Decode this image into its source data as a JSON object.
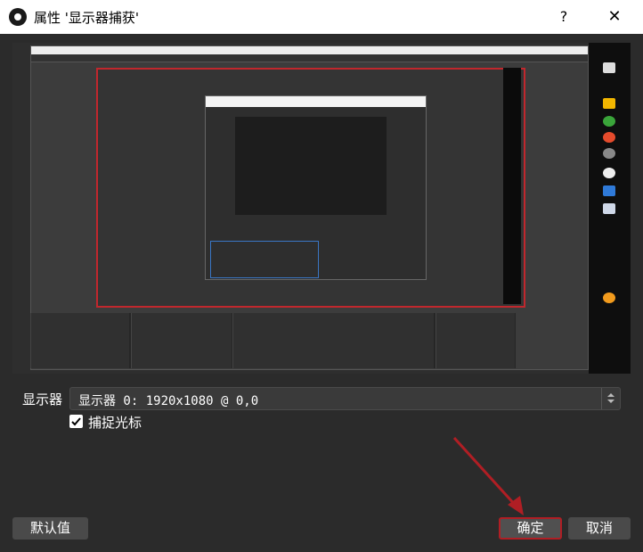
{
  "window": {
    "title": "属性 '显示器捕获'",
    "help_label": "?",
    "close_label": "✕"
  },
  "form": {
    "display_label": "显示器",
    "display_value": "显示器 0: 1920x1080 @ 0,0",
    "capture_cursor_label": "捕捉光标",
    "capture_cursor_checked": true
  },
  "buttons": {
    "defaults": "默认值",
    "ok": "确定",
    "cancel": "取消"
  },
  "colors": {
    "background": "#2b2b2b",
    "button": "#4a4a4a",
    "highlight": "#b01e24",
    "selection": "#3a76c4"
  }
}
